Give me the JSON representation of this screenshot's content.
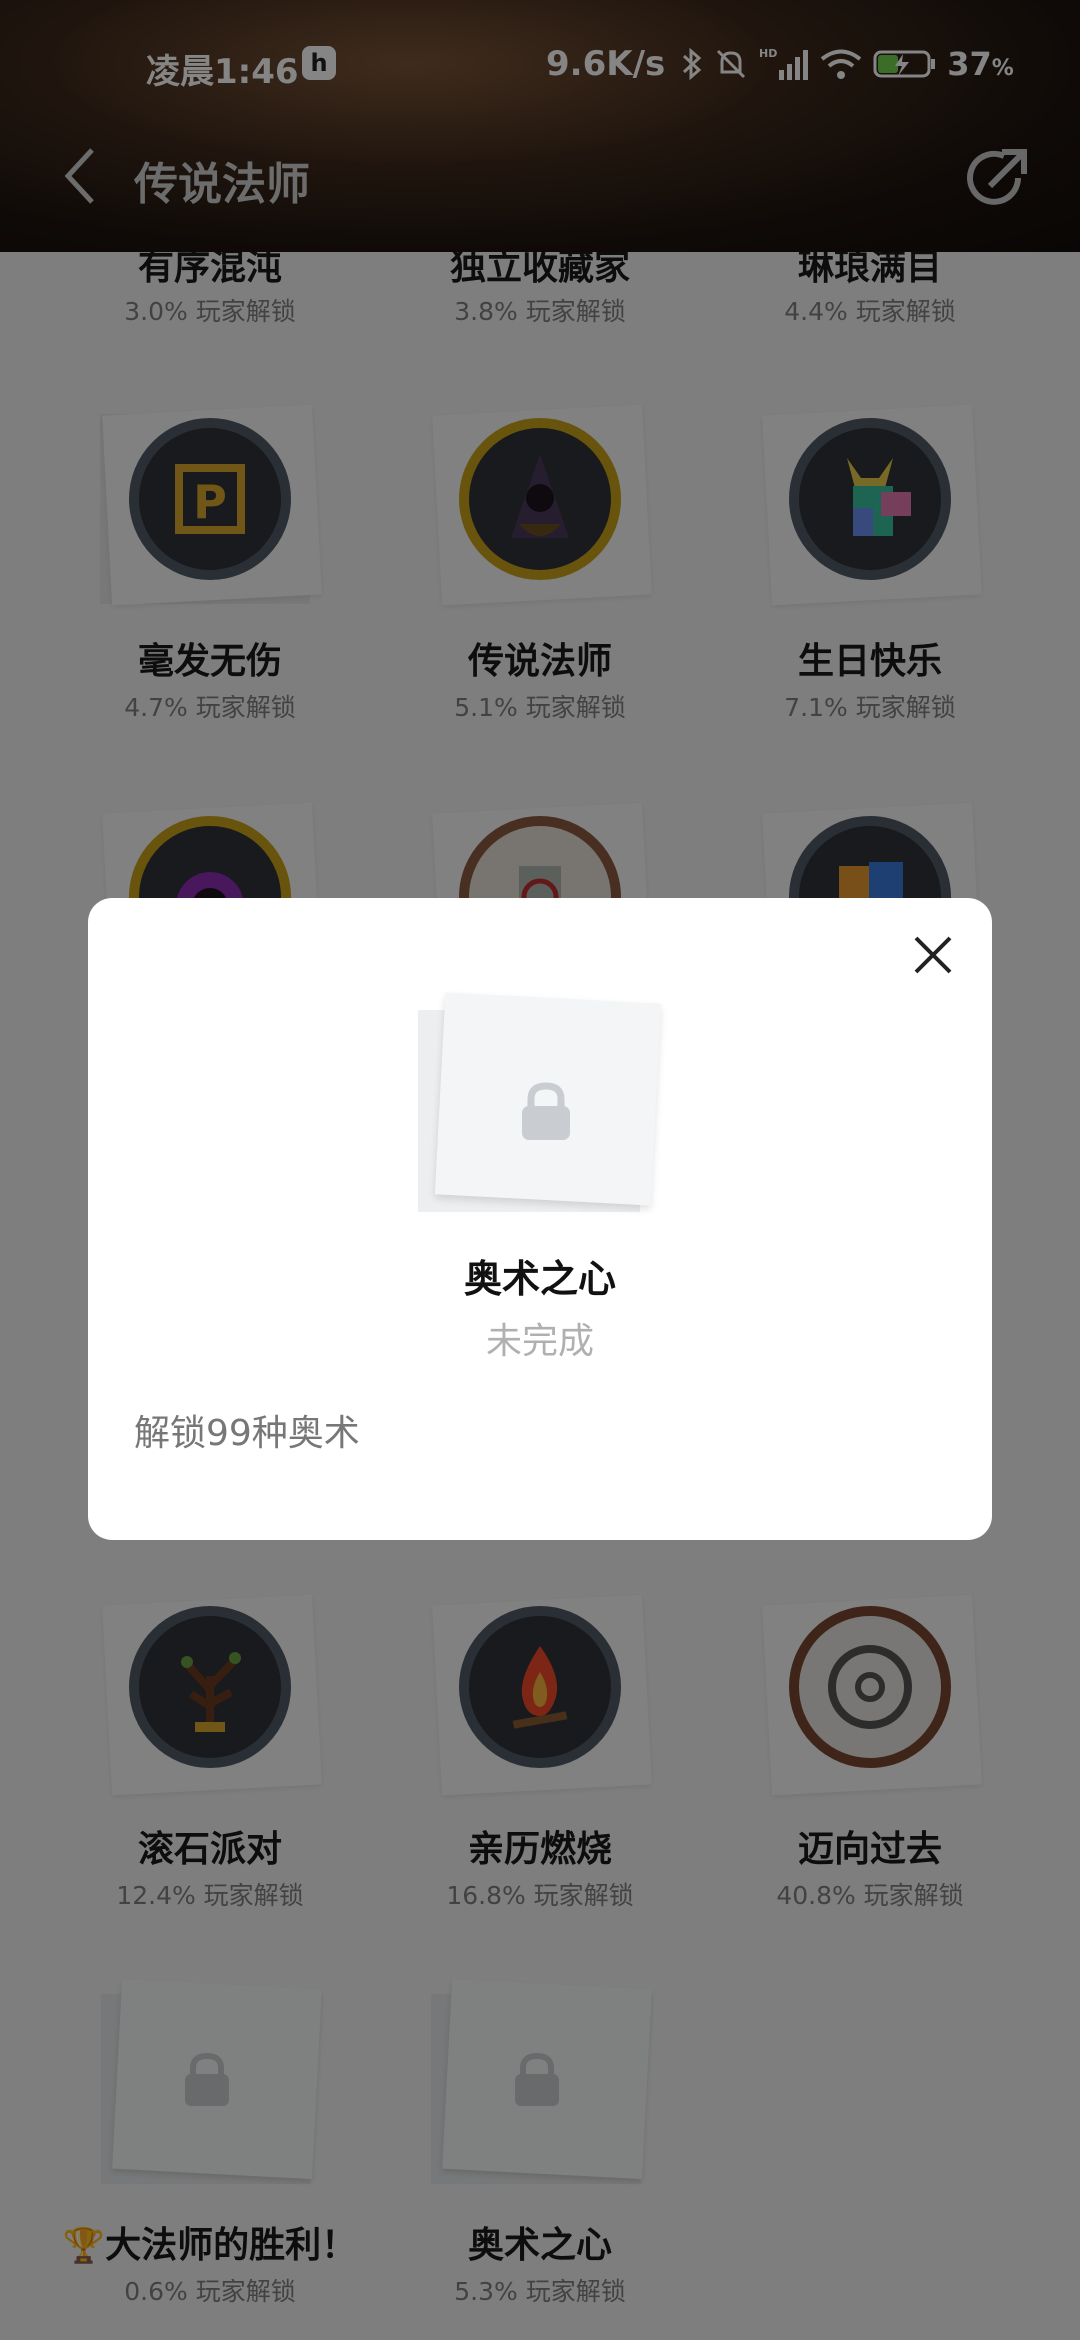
{
  "status_bar": {
    "time": "凌晨1:46",
    "app_badge": "h",
    "network_speed": "9.6K/s",
    "network_label": "HD",
    "battery": "37",
    "battery_unit": "%"
  },
  "nav": {
    "title": "传说法师"
  },
  "achievements": [
    {
      "title": "有序混沌",
      "percent": "3.0% 玩家解锁"
    },
    {
      "title": "独立收藏家",
      "percent": "3.8% 玩家解锁"
    },
    {
      "title": "琳琅满目",
      "percent": "4.4% 玩家解锁"
    },
    {
      "title": "毫发无伤",
      "percent": "4.7% 玩家解锁"
    },
    {
      "title": "传说法师",
      "percent": "5.1% 玩家解锁"
    },
    {
      "title": "生日快乐",
      "percent": "7.1% 玩家解锁"
    },
    {
      "title": "滚石派对",
      "percent": "12.4% 玩家解锁"
    },
    {
      "title": "亲历燃烧",
      "percent": "16.8% 玩家解锁"
    },
    {
      "title": "迈向过去",
      "percent": "40.8% 玩家解锁"
    },
    {
      "title": "大法师的胜利！",
      "percent": "0.6% 玩家解锁",
      "prefix_icon": "trophy-icon"
    },
    {
      "title": "奥术之心",
      "percent": "5.3% 玩家解锁"
    }
  ],
  "dialog": {
    "title": "奥术之心",
    "status": "未完成",
    "description": "解锁99种奥术"
  },
  "colors": {
    "overlay": "#000000",
    "dialog_bg": "#ffffff",
    "badge_ring": "#505b64",
    "gold_ring": "#c8a218"
  }
}
